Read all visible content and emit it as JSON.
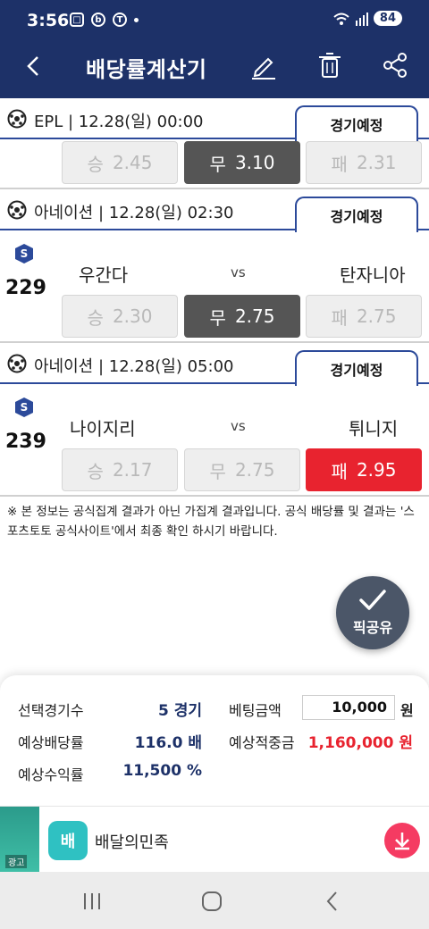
{
  "status": {
    "time": "3:56",
    "battery": "84"
  },
  "header": {
    "title": "배당률계산기"
  },
  "matches": [
    {
      "league": "EPL | 12.28(일) 00:00",
      "tab": "경기예정",
      "odds": [
        {
          "key": "승",
          "val": "2.45"
        },
        {
          "key": "무",
          "val": "3.10"
        },
        {
          "key": "패",
          "val": "2.31"
        }
      ],
      "selected": 1
    },
    {
      "league": "아네이션 | 12.28(일) 02:30",
      "tab": "경기예정",
      "badge": "S",
      "number": "229",
      "home": "우간다",
      "vs": "vs",
      "away": "탄자니아",
      "odds": [
        {
          "key": "승",
          "val": "2.30"
        },
        {
          "key": "무",
          "val": "2.75"
        },
        {
          "key": "패",
          "val": "2.75"
        }
      ],
      "selected": 1
    },
    {
      "league": "아네이션 | 12.28(일) 05:00",
      "tab": "경기예정",
      "badge": "S",
      "number": "239",
      "home": "나이지리",
      "vs": "vs",
      "away": "튀니지",
      "odds": [
        {
          "key": "승",
          "val": "2.17"
        },
        {
          "key": "무",
          "val": "2.75"
        },
        {
          "key": "패",
          "val": "2.95"
        }
      ],
      "selected": 2
    }
  ],
  "notice": "※ 본 정보는 공식집계 결과가 아닌 가집계 결과입니다. 공식 배당률 및 결과는 '스포츠토토 공식사이트'에서 최종 확인 하시기 바랍니다.",
  "fab": {
    "label": "픽공유"
  },
  "summary": {
    "games_label": "선택경기수",
    "games_value": "5 경기",
    "bet_label": "베팅금액",
    "bet_value": "10,000",
    "bet_unit": "원",
    "odds_label": "예상배당률",
    "odds_value": "116.0 배",
    "payout_label": "예상적중금",
    "payout_value": "1,160,000 원",
    "return_label": "예상수익률",
    "return_value": "11,500 %"
  },
  "ad": {
    "tag": "광고",
    "app_icon_text": "배",
    "app_name": "배달의민족"
  },
  "colors": {
    "header": "#1d3168",
    "accent": "#2c4a9a",
    "selected": "#555555",
    "highlight": "#e8232f"
  }
}
